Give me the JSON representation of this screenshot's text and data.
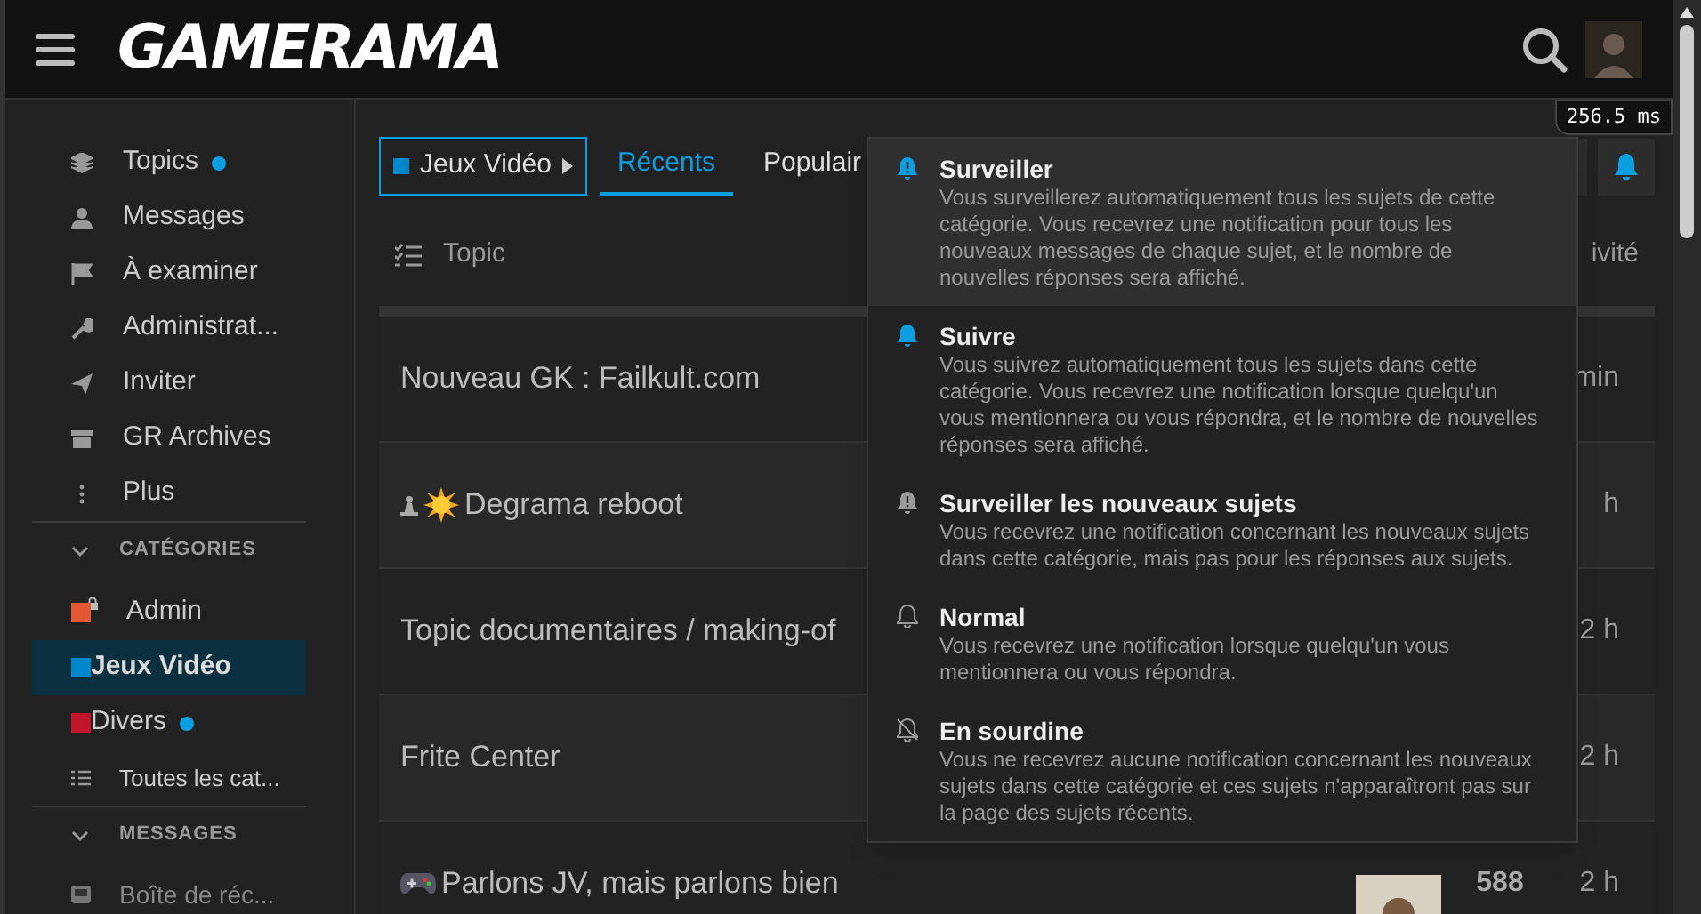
{
  "header": {
    "logo": "GAMERAMA",
    "timer": "256.5 ms"
  },
  "sidebar": {
    "items": [
      {
        "label": "Topics",
        "kind": "topics",
        "unread": true
      },
      {
        "label": "Messages",
        "kind": "user",
        "unread": false
      },
      {
        "label": "À examiner",
        "kind": "flag",
        "unread": false
      },
      {
        "label": "Administrat...",
        "kind": "wrench",
        "unread": false
      },
      {
        "label": "Inviter",
        "kind": "send",
        "unread": false
      },
      {
        "label": "GR Archives",
        "kind": "archive",
        "unread": false
      },
      {
        "label": "Plus",
        "kind": "more",
        "unread": false
      }
    ],
    "sections": [
      {
        "title": "CATÉGORIES",
        "expanded": true,
        "items": [
          {
            "label": "Admin",
            "color": "#e45735",
            "locked": true,
            "unread": false,
            "selected": false
          },
          {
            "label": "Jeux Vidéo",
            "color": "#0088cc",
            "locked": false,
            "unread": false,
            "selected": true
          },
          {
            "label": "Divers",
            "color": "#c3152a",
            "locked": false,
            "unread": true,
            "selected": false
          }
        ],
        "all_link": "Toutes les cat..."
      },
      {
        "title": "MESSAGES",
        "expanded": true,
        "inbox": "Boîte de réc..."
      }
    ]
  },
  "nav": {
    "category": {
      "label": "Jeux Vidéo",
      "color": "#0088cc"
    },
    "tabs": [
      {
        "label": "Récents",
        "selected": true
      },
      {
        "label": "Populair",
        "selected": false
      }
    ]
  },
  "table": {
    "columns": {
      "topic": "Topic",
      "activity": "ivité"
    },
    "rows": [
      {
        "title": "Nouveau GK : Failkult.com",
        "kind": "plain",
        "activity": "min"
      },
      {
        "title": "Degrama reboot",
        "kind": "pinned",
        "activity": "h"
      },
      {
        "title": "Topic documentaires / making-of",
        "kind": "plain",
        "activity": "2 h"
      },
      {
        "title": "Frite Center",
        "kind": "plain",
        "activity": "2 h"
      },
      {
        "title": "Parlons JV, mais parlons bien",
        "kind": "game",
        "activity": "2 h",
        "replies": "588"
      }
    ]
  },
  "notification_menu": {
    "options": [
      {
        "kind": "watching",
        "title": "Surveiller",
        "description": "Vous surveillerez automatiquement tous les sujets de cette catégorie. Vous recevrez une notification pour tous les nouveaux messages de chaque sujet, et le nombre de nouvelles réponses sera affiché.",
        "selected": true
      },
      {
        "kind": "tracking",
        "title": "Suivre",
        "description": "Vous suivrez automatiquement tous les sujets dans cette catégorie. Vous recevrez une notification lorsque quelqu'un vous mentionnera ou vous répondra, et le nombre de nouvelles réponses sera affiché.",
        "selected": false
      },
      {
        "kind": "watching_first",
        "title": "Surveiller les nouveaux sujets",
        "description": "Vous recevrez une notification concernant les nouveaux sujets dans cette catégorie, mais pas pour les réponses aux sujets.",
        "selected": false
      },
      {
        "kind": "regular",
        "title": "Normal",
        "description": "Vous recevrez une notification lorsque quelqu'un vous mentionnera ou vous répondra.",
        "selected": false
      },
      {
        "kind": "muted",
        "title": "En sourdine",
        "description": "Vous ne recevrez aucune notification concernant les nouveaux sujets dans cette catégorie et ces sujets n'apparaîtront pas sur la page des sujets récents.",
        "selected": false
      }
    ]
  }
}
